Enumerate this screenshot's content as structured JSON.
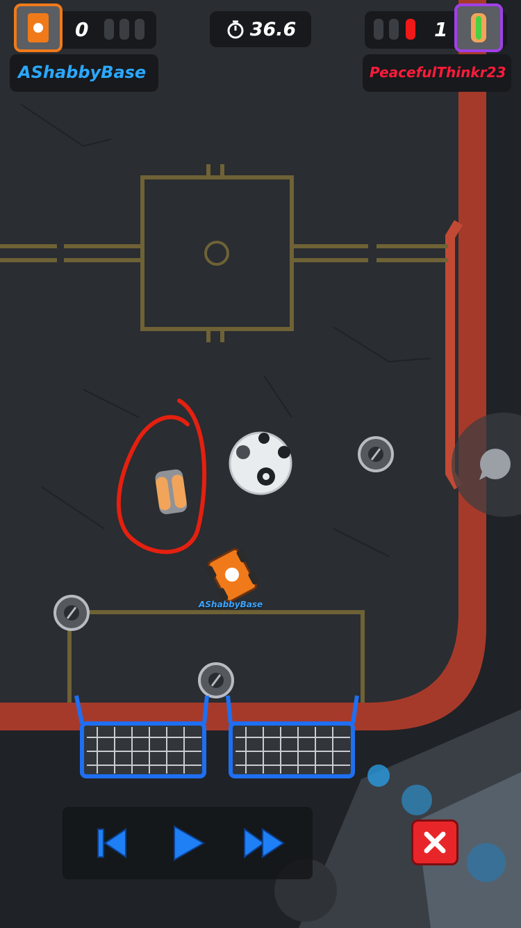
{
  "player_left": {
    "name": "AShabbyBase",
    "score": "0",
    "name_color": "#2aa8ff",
    "frame_color": "#f07a1a"
  },
  "player_right": {
    "name": "PeacefulThinkr23",
    "score": "1",
    "name_color": "#ff1b3a",
    "frame_color": "#a040e8"
  },
  "timer": {
    "value": "36.6",
    "icon": "stopwatch-icon"
  },
  "car_label": "AShabbyBase",
  "controls": {
    "rewind_icon": "skip-back-icon",
    "play_icon": "play-icon",
    "fast_forward_icon": "fast-forward-icon",
    "close_icon": "close-icon"
  },
  "colors": {
    "field": "#2a2d31",
    "wall": "#b2402e",
    "goal": "#1f6ff2",
    "annotation": "#e52010"
  }
}
